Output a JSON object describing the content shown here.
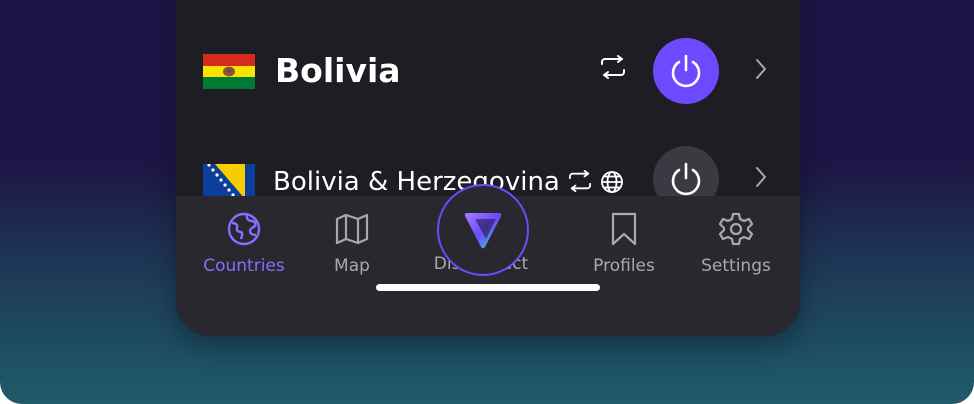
{
  "countries": [
    {
      "name": "Bolivia",
      "flag": "bolivia-flag",
      "power_state": "connected",
      "features": [
        "secure-core-icon"
      ]
    },
    {
      "name": "Bolivia & Herzegovina",
      "flag": "bosnia-flag",
      "power_state": "disconnected",
      "features": [
        "secure-core-icon",
        "globe-icon"
      ]
    }
  ],
  "tabbar": {
    "items": [
      {
        "label": "Countries",
        "icon": "globe-icon",
        "active": true
      },
      {
        "label": "Map",
        "icon": "map-icon",
        "active": false
      },
      {
        "label": "Disconnect",
        "icon": "proton-vpn-logo",
        "active": false
      },
      {
        "label": "Profiles",
        "icon": "bookmark-icon",
        "active": false
      },
      {
        "label": "Settings",
        "icon": "gear-icon",
        "active": false
      }
    ]
  },
  "colors": {
    "accent": "#6d4aff",
    "active_tab": "#8a6cff",
    "panel": "#1e1d23",
    "tabbar": "#29282f",
    "inactive_power": "#3b3a42"
  }
}
